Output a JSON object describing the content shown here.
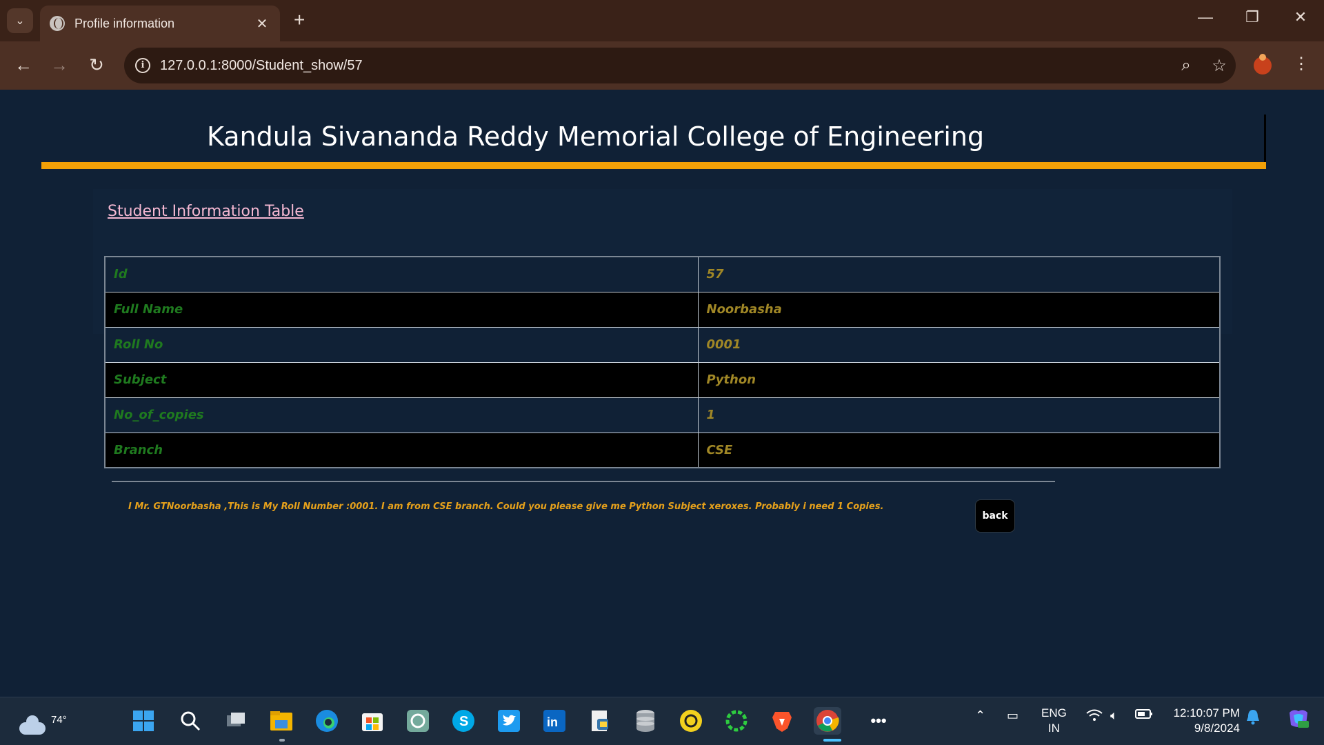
{
  "browser": {
    "tab_title": "Profile information",
    "url": "127.0.0.1:8000/Student_show/57",
    "new_tab": "+",
    "close": "✕"
  },
  "page": {
    "college_name": "Kandula Sivananda Reddy Memorial College of Engineering",
    "section_title": "Student Information Table",
    "rows": [
      {
        "label": "Id",
        "value": "57"
      },
      {
        "label": "Full Name",
        "value": "Noorbasha"
      },
      {
        "label": "Roll No",
        "value": "0001"
      },
      {
        "label": "Subject",
        "value": "Python"
      },
      {
        "label": "No_of_copies",
        "value": "1"
      },
      {
        "label": "Branch",
        "value": "CSE"
      }
    ],
    "message": "I Mr. GTNoorbasha ,This is My Roll Number :0001. I am from CSE branch. Could you please give me Python Subject xeroxes. Probably i need 1 Copies.",
    "back_label": "back",
    "accent_color": "#f2a007",
    "background_color": "#102136"
  },
  "taskbar": {
    "temperature": "74°",
    "language_line1": "ENG",
    "language_line2": "IN",
    "time": "12:10:07 PM",
    "date": "9/8/2024",
    "apps": [
      "windows-start-icon",
      "search-icon",
      "task-view-icon",
      "file-explorer-icon",
      "edge-icon",
      "microsoft-store-icon",
      "chatgpt-icon",
      "skype-icon",
      "twitter-icon",
      "linkedin-icon",
      "python-file-icon",
      "database-icon",
      "settings-gear-icon",
      "loading-ring-icon",
      "brave-icon",
      "chrome-icon",
      "more-icon"
    ]
  }
}
